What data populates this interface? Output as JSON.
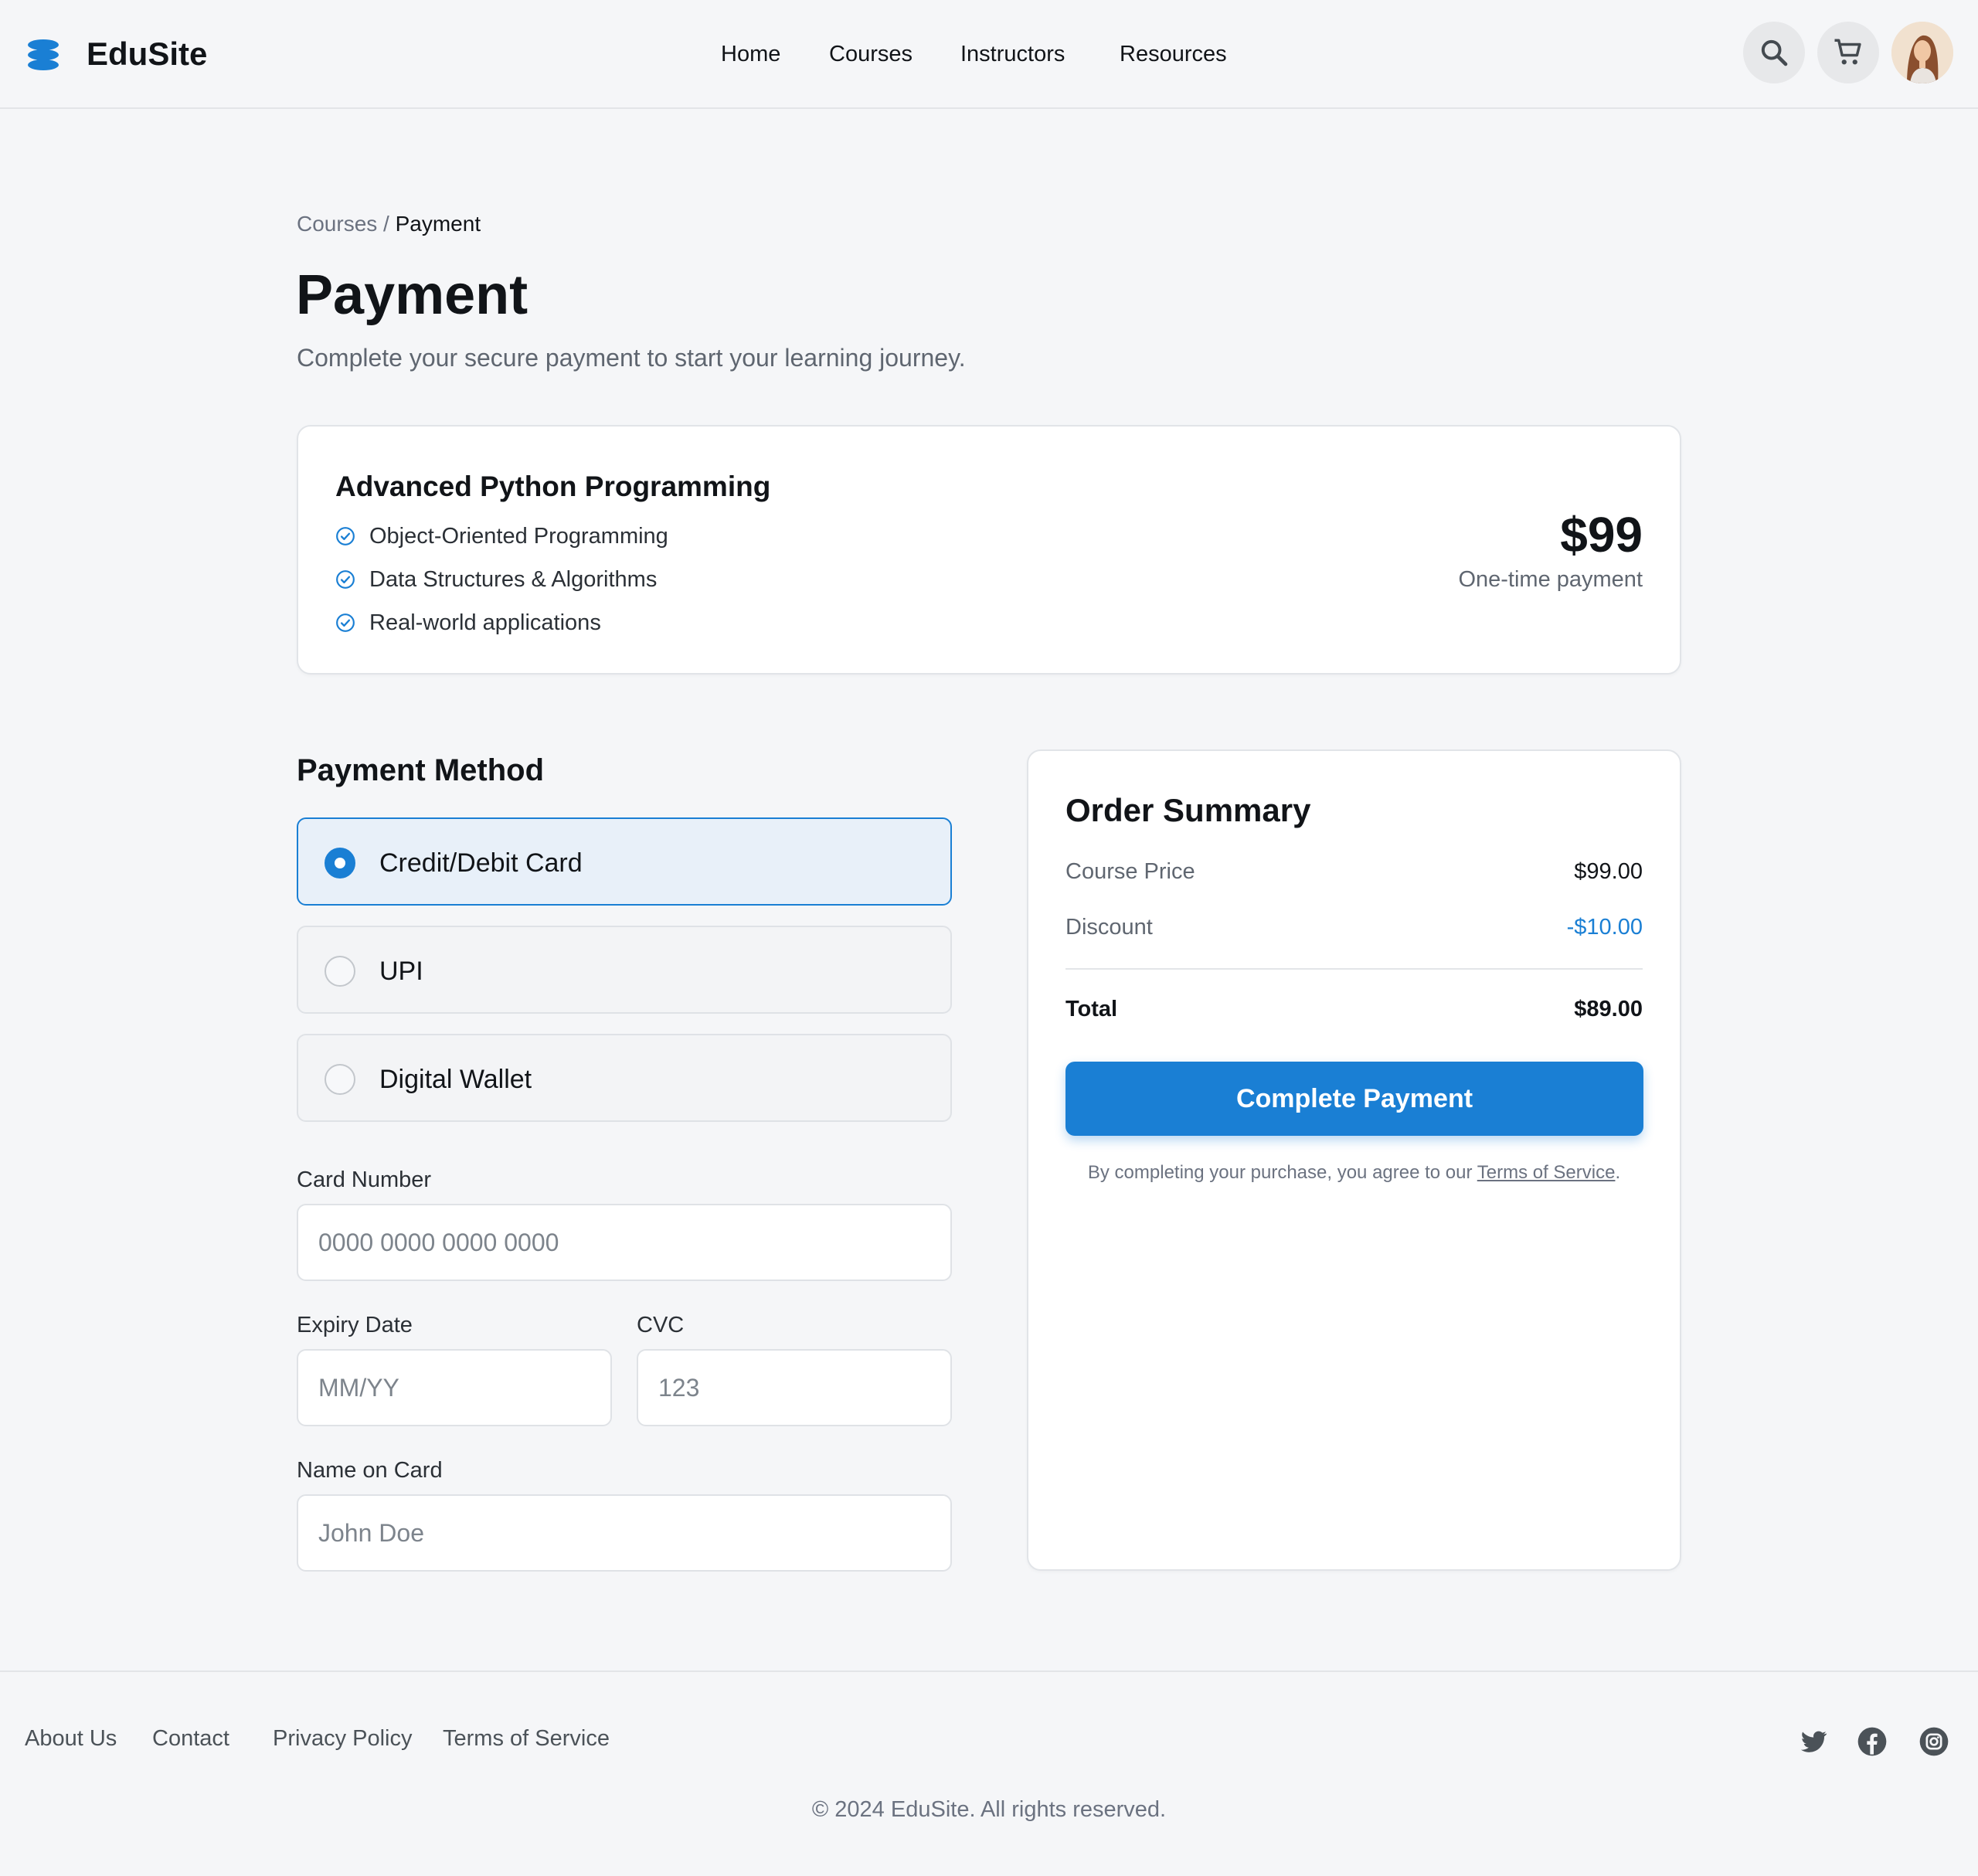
{
  "app": {
    "brand": "EduSite",
    "accent_color": "#1a7fd4"
  },
  "nav": {
    "items": [
      "Home",
      "Courses",
      "Instructors",
      "Resources"
    ]
  },
  "header_icons": [
    "search-icon",
    "cart-icon",
    "user-avatar"
  ],
  "breadcrumb": {
    "parent": "Courses",
    "separator": " / ",
    "current": "Payment"
  },
  "page": {
    "title": "Payment",
    "subtitle": "Complete your secure payment to start your learning journey."
  },
  "course": {
    "title": "Advanced Python Programming",
    "features": [
      "Object-Oriented Programming",
      "Data Structures & Algorithms",
      "Real-world applications"
    ],
    "price": "$99",
    "price_note": "One-time payment"
  },
  "payment_method": {
    "title": "Payment Method",
    "options": [
      {
        "label": "Credit/Debit Card",
        "selected": true
      },
      {
        "label": "UPI",
        "selected": false
      },
      {
        "label": "Digital Wallet",
        "selected": false
      }
    ]
  },
  "form": {
    "card_number": {
      "label": "Card Number",
      "placeholder": "0000 0000 0000 0000"
    },
    "expiry": {
      "label": "Expiry Date",
      "placeholder": "MM/YY"
    },
    "cvc": {
      "label": "CVC",
      "placeholder": "123"
    },
    "name": {
      "label": "Name on Card",
      "placeholder": "John Doe"
    }
  },
  "summary": {
    "title": "Order Summary",
    "course_price_label": "Course Price",
    "course_price": "$99.00",
    "discount_label": "Discount",
    "discount": "-$10.00",
    "total_label": "Total",
    "total": "$89.00",
    "button": "Complete Payment",
    "legal_prefix": "By completing your purchase, you agree to our ",
    "legal_link": "Terms of Service",
    "legal_suffix": "."
  },
  "footer": {
    "links": [
      "About Us",
      "Contact",
      "Privacy Policy",
      "Terms of Service"
    ],
    "social": [
      "twitter-icon",
      "facebook-icon",
      "instagram-icon"
    ],
    "copyright": "© 2024 EduSite. All rights reserved."
  }
}
